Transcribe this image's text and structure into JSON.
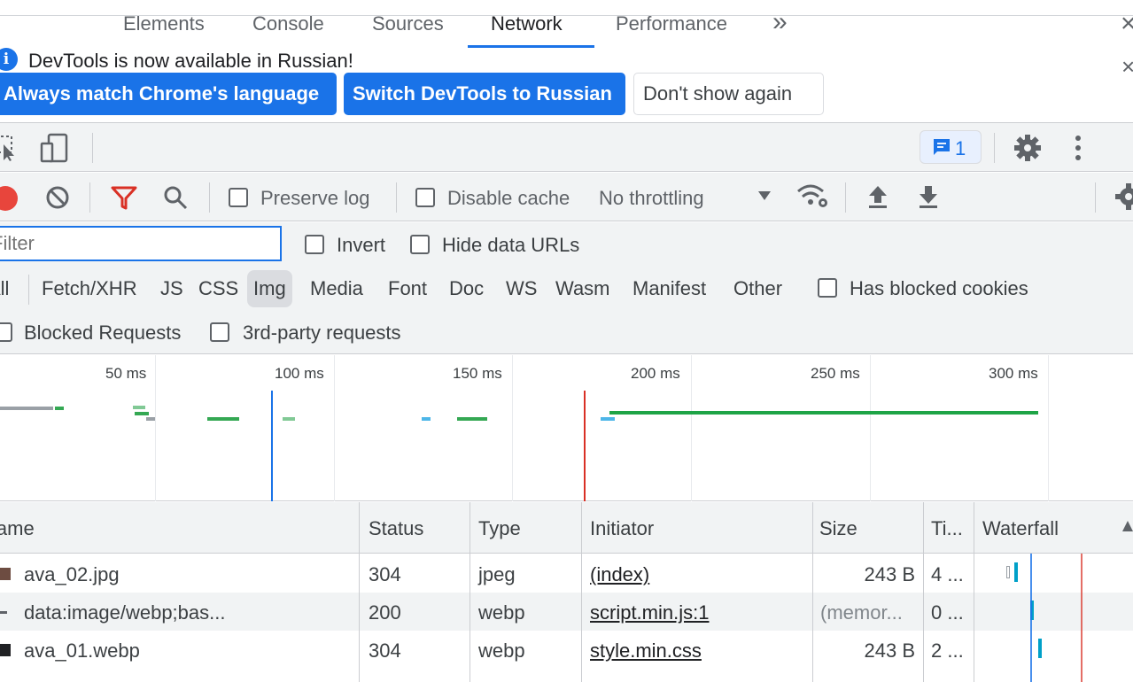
{
  "infobar": {
    "message": "DevTools is now available in Russian!",
    "buttons": {
      "always_match": "Always match Chrome's language",
      "switch": "Switch DevTools to Russian",
      "dont_show": "Don't show again"
    },
    "close_glyph": "×"
  },
  "tabs": {
    "items": [
      "Elements",
      "Console",
      "Sources",
      "Network",
      "Performance"
    ],
    "active": "Network",
    "more_glyph": "»",
    "issues_count": "1"
  },
  "toolbar": {
    "preserve_log": "Preserve log",
    "disable_cache": "Disable cache",
    "throttling": "No throttling",
    "record_color": "#e8453c",
    "filter_color": "#d93025"
  },
  "filters": {
    "placeholder": "Filter",
    "invert": "Invert",
    "hide_data_urls": "Hide data URLs",
    "types": [
      "All",
      "Fetch/XHR",
      "JS",
      "CSS",
      "Img",
      "Media",
      "Font",
      "Doc",
      "WS",
      "Wasm",
      "Manifest",
      "Other"
    ],
    "selected_type": "Img",
    "has_blocked_cookies": "Has blocked cookies",
    "blocked_requests": "Blocked Requests",
    "third_party": "3rd-party requests"
  },
  "overview": {
    "ticks": [
      "50 ms",
      "100 ms",
      "150 ms",
      "200 ms",
      "250 ms",
      "300 ms"
    ],
    "dom_content_loaded_color": "#1a73e8",
    "load_color": "#d93025"
  },
  "table": {
    "columns": [
      "Name",
      "Status",
      "Type",
      "Initiator",
      "Size",
      "Ti...",
      "Waterfall"
    ],
    "rows": [
      {
        "name": "ava_02.jpg",
        "status": "304",
        "type": "jpeg",
        "initiator": "(index)",
        "size": "243 B",
        "time": "4 ..."
      },
      {
        "name": "data:image/webp;bas...",
        "status": "200",
        "type": "webp",
        "initiator": "script.min.js:1",
        "size": "(memor...",
        "time": "0 ..."
      },
      {
        "name": "ava_01.webp",
        "status": "304",
        "type": "webp",
        "initiator": "style.min.css",
        "size": "243 B",
        "time": "2 ..."
      }
    ]
  }
}
